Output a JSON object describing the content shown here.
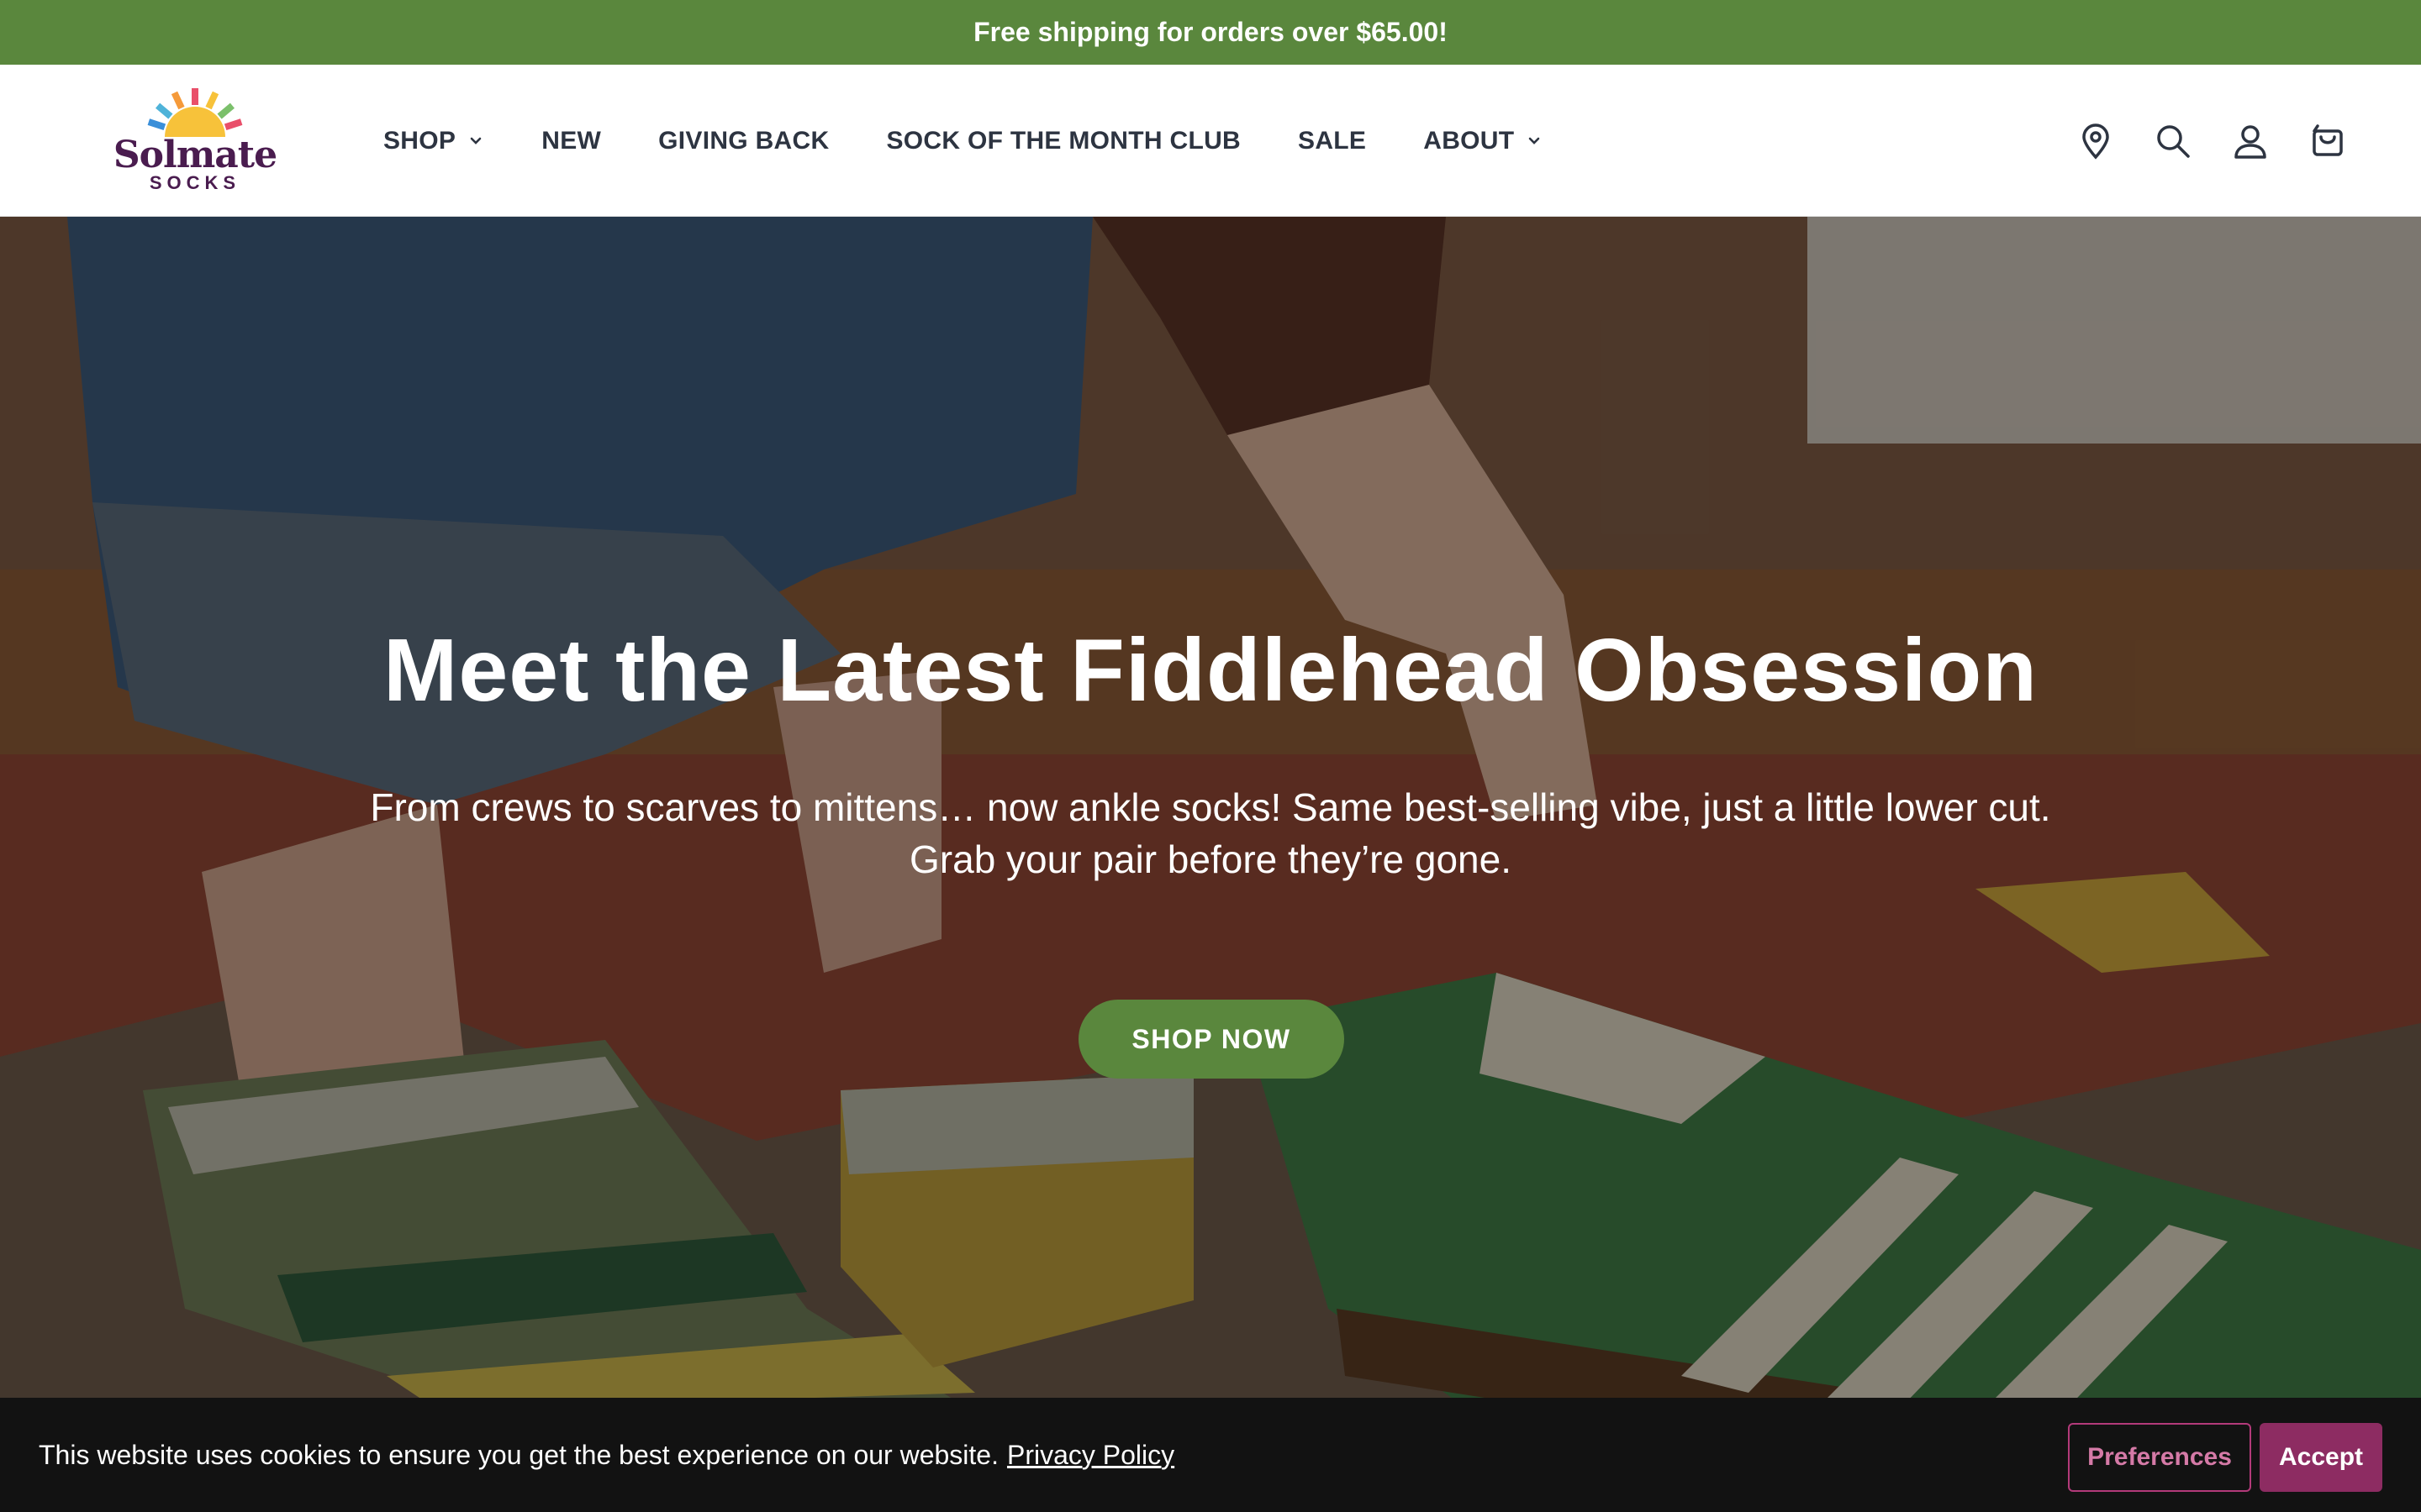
{
  "announcement": {
    "text": "Free shipping for orders over $65.00!"
  },
  "brand": {
    "name": "Solmate",
    "sub": "SOCKS",
    "primary_color": "#5a873d",
    "logo_color": "#4a1c4f"
  },
  "nav": {
    "items": [
      {
        "label": "SHOP",
        "has_dropdown": true
      },
      {
        "label": "NEW",
        "has_dropdown": false
      },
      {
        "label": "GIVING BACK",
        "has_dropdown": false
      },
      {
        "label": "SOCK OF THE MONTH CLUB",
        "has_dropdown": false
      },
      {
        "label": "SALE",
        "has_dropdown": false
      },
      {
        "label": "ABOUT",
        "has_dropdown": true
      }
    ]
  },
  "header_icons": [
    "location-pin-icon",
    "search-icon",
    "account-icon",
    "cart-icon"
  ],
  "hero": {
    "title": "Meet the Latest Fiddlehead Obsession",
    "subtitle": "From crews to scarves to mittens… now ankle socks! Same best-selling vibe, just a little lower cut. Grab your pair before they’re gone.",
    "cta": "SHOP NOW"
  },
  "cookie": {
    "message": "This website uses cookies to ensure you get the best experience on our website.",
    "link": "Privacy Policy",
    "preferences": "Preferences",
    "accept": "Accept",
    "accent_color": "#8d2c62"
  }
}
